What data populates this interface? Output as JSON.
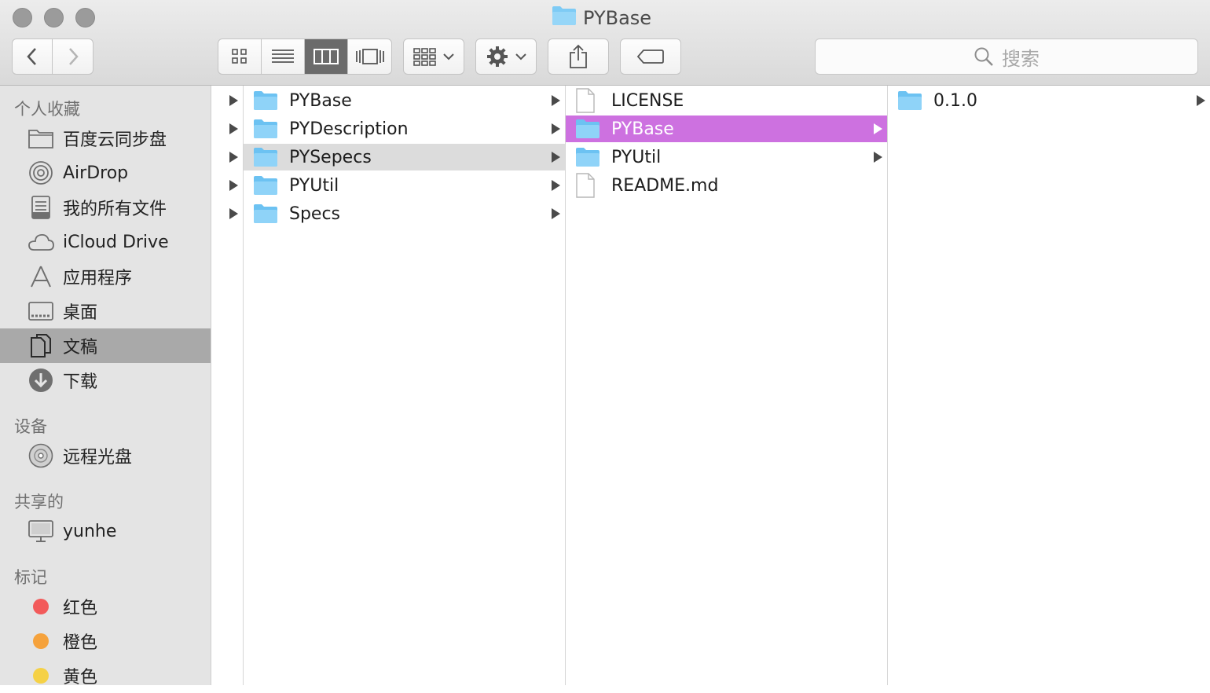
{
  "window": {
    "title": "PYBase"
  },
  "toolbar": {
    "search_placeholder": "搜索"
  },
  "sidebar": {
    "sections": [
      {
        "header": "个人收藏",
        "items": [
          {
            "label": "百度云同步盘",
            "icon": "folder-icon"
          },
          {
            "label": "AirDrop",
            "icon": "airdrop-icon"
          },
          {
            "label": "我的所有文件",
            "icon": "all-files-icon"
          },
          {
            "label": "iCloud Drive",
            "icon": "cloud-icon"
          },
          {
            "label": "应用程序",
            "icon": "applications-icon"
          },
          {
            "label": "桌面",
            "icon": "desktop-icon"
          },
          {
            "label": "文稿",
            "icon": "documents-icon"
          },
          {
            "label": "下载",
            "icon": "download-icon"
          }
        ]
      },
      {
        "header": "设备",
        "items": [
          {
            "label": "远程光盘",
            "icon": "disc-icon"
          }
        ]
      },
      {
        "header": "共享的",
        "items": [
          {
            "label": "yunhe",
            "icon": "computer-icon"
          }
        ]
      },
      {
        "header": "标记",
        "items": [
          {
            "label": "红色",
            "color": "#f25a5a"
          },
          {
            "label": "橙色",
            "color": "#f5a23c"
          },
          {
            "label": "黄色",
            "color": "#f5d146"
          }
        ]
      }
    ]
  },
  "columns": [
    {
      "items": [
        {
          "name": "PYBase",
          "type": "folder"
        },
        {
          "name": "PYDescription",
          "type": "folder"
        },
        {
          "name": "PYSepecs",
          "type": "folder",
          "state": "inactive-selected"
        },
        {
          "name": "PYUtil",
          "type": "folder"
        },
        {
          "name": "Specs",
          "type": "folder"
        }
      ]
    },
    {
      "items": [
        {
          "name": "LICENSE",
          "type": "file"
        },
        {
          "name": "PYBase",
          "type": "folder",
          "state": "selected"
        },
        {
          "name": "PYUtil",
          "type": "folder"
        },
        {
          "name": "README.md",
          "type": "file"
        }
      ]
    },
    {
      "items": [
        {
          "name": "0.1.0",
          "type": "folder"
        }
      ]
    }
  ],
  "colors": {
    "selection": "#cd71e0",
    "folder": "#7ecbf5"
  }
}
